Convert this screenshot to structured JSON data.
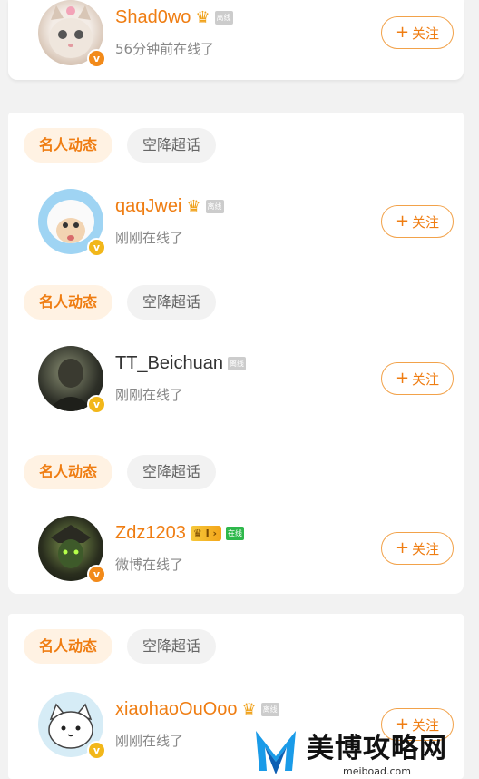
{
  "follow_label": "关注",
  "chips": {
    "hot": "名人动态",
    "plain": "空降超话"
  },
  "users": [
    {
      "name": "Shad0wo",
      "status": "56分钟前在线了",
      "online_tag": "离线"
    },
    {
      "name": "qaqJwei",
      "status": "刚刚在线了",
      "online_tag": "离线"
    },
    {
      "name": "TT_Beichuan",
      "status": "刚刚在线了",
      "online_tag": "离线"
    },
    {
      "name": "Zdz1203",
      "status": "微博在线了",
      "online_tag": "在线",
      "level": "I"
    },
    {
      "name": "xiaohaoOuOoo",
      "status": "刚刚在线了",
      "online_tag": "离线"
    }
  ],
  "watermark": {
    "text": "美博攻略网",
    "url": "meiboad.com"
  },
  "colors": {
    "accent": "#ef7d12",
    "chip_bg": "#fff2e3"
  }
}
